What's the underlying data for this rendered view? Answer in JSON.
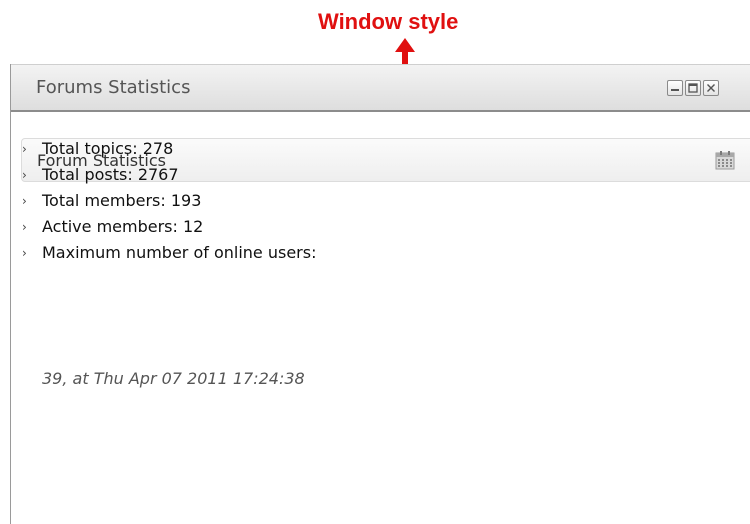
{
  "annotation": {
    "label": "Window style",
    "color": "#e01010"
  },
  "window": {
    "title": "Forums Statistics",
    "controls": {
      "minimize_icon": "minimize-icon",
      "maximize_icon": "maximize-icon",
      "close_icon": "close-icon"
    }
  },
  "panel": {
    "title": "Forum Statistics",
    "icon": "calendar-icon"
  },
  "stats": {
    "items": [
      {
        "label": "Total topics: 278"
      },
      {
        "label": "Total posts: 2767"
      },
      {
        "label": "Total members: 193"
      },
      {
        "label": "Active members: 12"
      },
      {
        "label": "Maximum number of online users:"
      }
    ],
    "max_online_detail": "39, at Thu Apr 07 2011 17:24:38"
  }
}
